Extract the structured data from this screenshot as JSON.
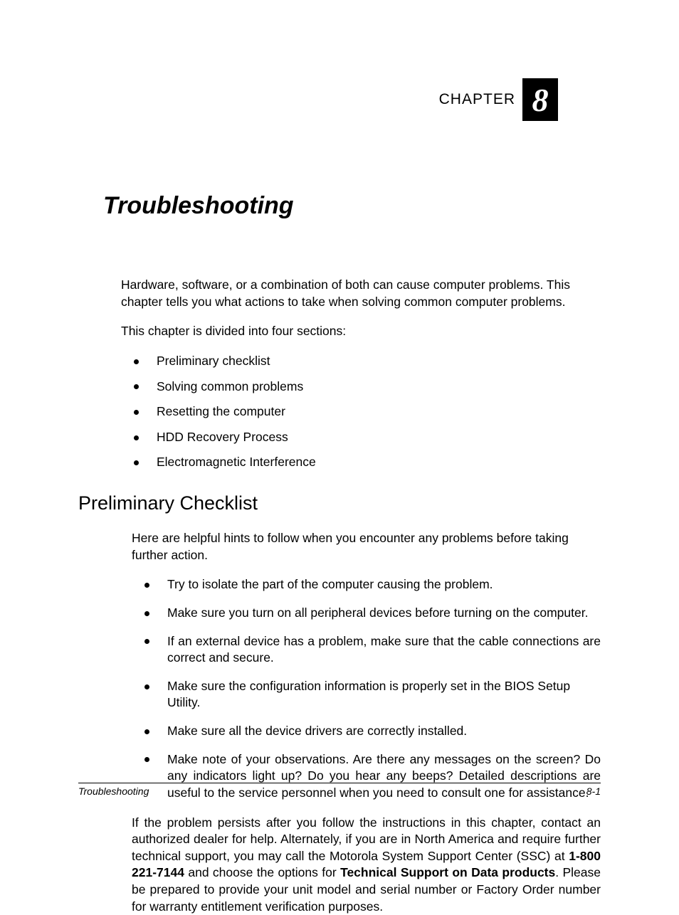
{
  "chapter": {
    "label": "CHAPTER",
    "number": "8",
    "title": "Troubleshooting"
  },
  "intro": {
    "p1": "Hardware, software, or a combination of both can cause computer problems. This chapter tells you what actions to take when solving common computer problems.",
    "p2": "This chapter is divided into four sections:"
  },
  "sections_list": [
    "Preliminary checklist",
    "Solving common problems",
    "Resetting the computer",
    "HDD Recovery Process",
    "Electromagnetic Interference"
  ],
  "preliminary": {
    "heading": "Preliminary Checklist",
    "lead": "Here are helpful hints to follow when you encounter any problems before taking further action.",
    "items": [
      "Try to isolate the part of the computer causing the problem.",
      "Make sure you turn on all peripheral devices before turning on the computer.",
      "If an external device has a problem, make sure that the cable connections are correct and secure.",
      "Make sure the configuration information is properly set in the BIOS Setup Utility.",
      "Make sure all the device drivers are correctly installed.",
      "Make note of your observations. Are there any messages on the screen?  Do any indicators light up?  Do you hear any beeps?  Detailed descriptions are useful to the service personnel when you need to consult one for assistance."
    ],
    "closing": {
      "pre": "If the problem persists after you follow the instructions in this chapter, contact an authorized dealer for help. Alternately, if you are in North America and require further technical support, you may call the Motorola System Support Center (SSC) at ",
      "phone": "1-800 221-7144",
      "mid": " and choose the options for ",
      "bold2": "Technical Support on Data products",
      "post": ".  Please be prepared to provide your unit model and serial number or Factory Order number for warranty entitlement verification purposes."
    }
  },
  "footer": {
    "left": "Troubleshooting",
    "right": "8-1"
  }
}
